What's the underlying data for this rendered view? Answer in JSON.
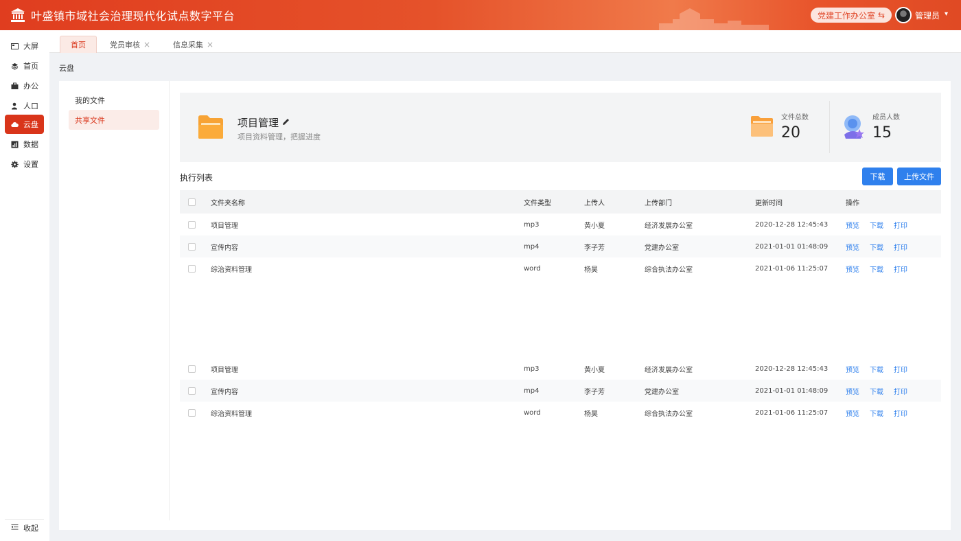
{
  "header": {
    "title": "叶盛镇市域社会治理现代化试点数字平台",
    "office": "党建工作办公室",
    "user": "管理员"
  },
  "sidebar": {
    "items": [
      {
        "label": "大屏",
        "icon": "screen-icon"
      },
      {
        "label": "首页",
        "icon": "layers-icon"
      },
      {
        "label": "办公",
        "icon": "briefcase-icon"
      },
      {
        "label": "人口",
        "icon": "person-icon"
      },
      {
        "label": "云盘",
        "icon": "cloud-icon",
        "active": true
      },
      {
        "label": "数据",
        "icon": "chart-icon"
      },
      {
        "label": "设置",
        "icon": "gear-icon"
      }
    ],
    "collapse": "收起"
  },
  "tabs": [
    {
      "label": "首页",
      "active": true
    },
    {
      "label": "党员审核"
    },
    {
      "label": "信息采集"
    }
  ],
  "breadcrumb": "云盘",
  "subnav": [
    {
      "label": "我的文件"
    },
    {
      "label": "共享文件",
      "active": true
    }
  ],
  "project": {
    "title": "项目管理",
    "desc": "项目资料管理，把握进度"
  },
  "stats": {
    "files_label": "文件总数",
    "files_value": "20",
    "members_label": "成员人数",
    "members_value": "15"
  },
  "list": {
    "title": "执行列表",
    "download": "下载",
    "upload": "上传文件",
    "headers": {
      "name": "文件夹名称",
      "type": "文件类型",
      "uploader": "上传人",
      "dept": "上传部门",
      "time": "更新时间",
      "ops": "操作"
    },
    "ops": {
      "preview": "预览",
      "download": "下载",
      "print": "打印"
    },
    "rows": [
      {
        "name": "项目管理",
        "type": "mp3",
        "uploader": "黄小夏",
        "dept": "经济发展办公室",
        "time": "2020-12-28 12:45:43"
      },
      {
        "name": "宣传内容",
        "type": "mp4",
        "uploader": "李子芳",
        "dept": "党建办公室",
        "time": "2021-01-01 01:48:09"
      },
      {
        "name": "综治资料管理",
        "type": "word",
        "uploader": "杨昊",
        "dept": "综合执法办公室",
        "time": "2021-01-06 11:25:07"
      },
      {
        "name": "项目管理",
        "type": "mp3",
        "uploader": "黄小夏",
        "dept": "经济发展办公室",
        "time": "2020-12-28 12:45:43"
      },
      {
        "name": "宣传内容",
        "type": "mp4",
        "uploader": "李子芳",
        "dept": "党建办公室",
        "time": "2021-01-01 01:48:09"
      },
      {
        "name": "综治资料管理",
        "type": "word",
        "uploader": "杨昊",
        "dept": "综合执法办公室",
        "time": "2021-01-06 11:25:07"
      }
    ]
  },
  "colors": {
    "brand": "#d9351a",
    "link": "#2f80ed"
  }
}
